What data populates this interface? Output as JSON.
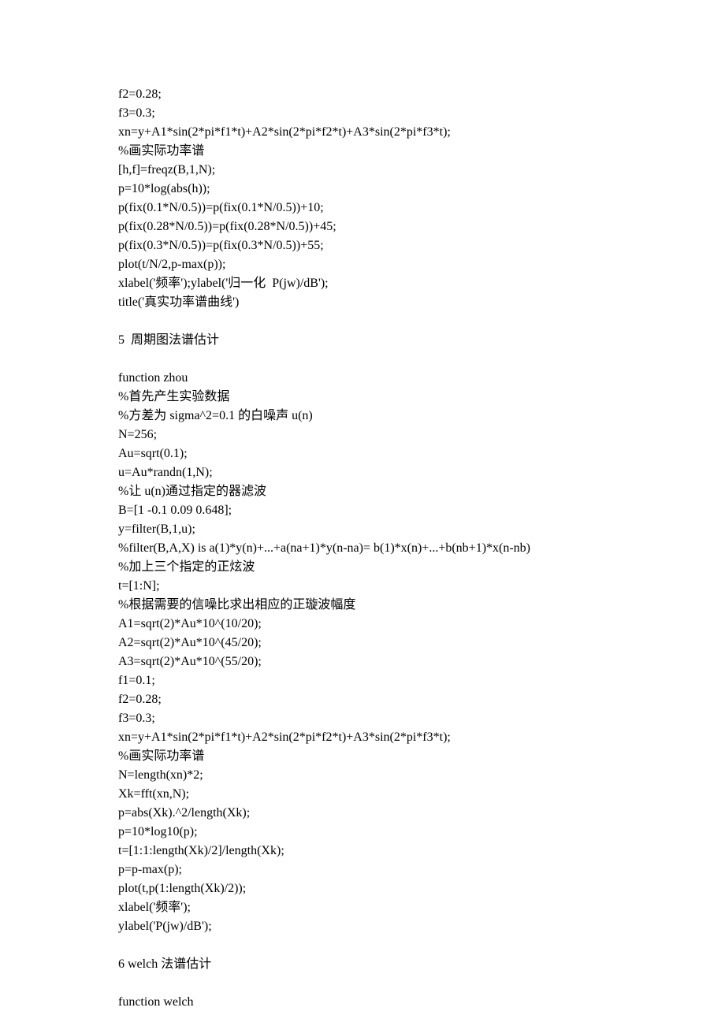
{
  "block1": [
    "f2=0.28;",
    "f3=0.3;",
    "xn=y+A1*sin(2*pi*f1*t)+A2*sin(2*pi*f2*t)+A3*sin(2*pi*f3*t);",
    "%画实际功率谱",
    "[h,f]=freqz(B,1,N);",
    "p=10*log(abs(h));",
    "p(fix(0.1*N/0.5))=p(fix(0.1*N/0.5))+10;",
    "p(fix(0.28*N/0.5))=p(fix(0.28*N/0.5))+45;",
    "p(fix(0.3*N/0.5))=p(fix(0.3*N/0.5))+55;",
    "plot(t/N/2,p-max(p));",
    "xlabel('频率');ylabel('归一化  P(jw)/dB');",
    "title('真实功率谱曲线')"
  ],
  "heading1": "5  周期图法谱估计",
  "block2": [
    "function zhou",
    "%首先产生实验数据",
    "%方差为 sigma^2=0.1 的白噪声 u(n)",
    "N=256;",
    "Au=sqrt(0.1);",
    "u=Au*randn(1,N);",
    "%让 u(n)通过指定的器滤波",
    "B=[1 -0.1 0.09 0.648];",
    "y=filter(B,1,u);",
    "%filter(B,A,X) is a(1)*y(n)+...+a(na+1)*y(n-na)= b(1)*x(n)+...+b(nb+1)*x(n-nb)",
    "%加上三个指定的正炫波",
    "t=[1:N];",
    "%根据需要的信噪比求出相应的正璇波幅度",
    "A1=sqrt(2)*Au*10^(10/20);",
    "A2=sqrt(2)*Au*10^(45/20);",
    "A3=sqrt(2)*Au*10^(55/20);",
    "f1=0.1;",
    "f2=0.28;",
    "f3=0.3;",
    "xn=y+A1*sin(2*pi*f1*t)+A2*sin(2*pi*f2*t)+A3*sin(2*pi*f3*t);",
    "%画实际功率谱",
    "N=length(xn)*2;",
    "Xk=fft(xn,N);",
    "p=abs(Xk).^2/length(Xk);",
    "p=10*log10(p);",
    "t=[1:1:length(Xk)/2]/length(Xk);",
    "p=p-max(p);",
    "plot(t,p(1:length(Xk)/2));",
    "xlabel('频率');",
    "ylabel('P(jw)/dB');"
  ],
  "heading2": "6 welch 法谱估计",
  "block3": [
    "function welch"
  ]
}
